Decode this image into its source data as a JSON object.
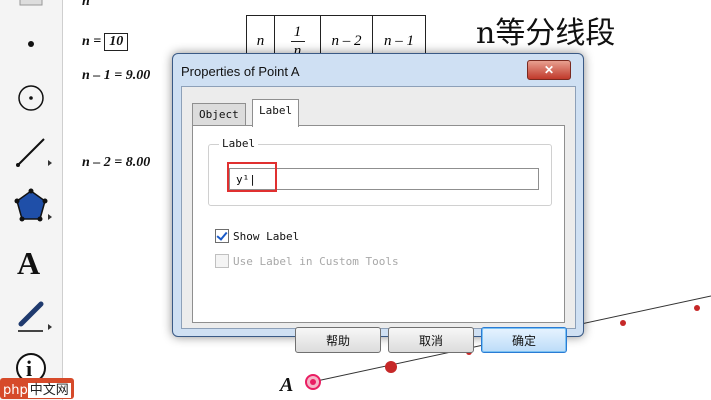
{
  "canvas": {
    "title": "n等分线段",
    "n_symbol": "n",
    "n_label": "n =",
    "n_value": "10",
    "n_minus_1": "n – 1 = 9.00",
    "n_minus_2": "n – 2 = 8.00",
    "point_label": "A"
  },
  "formula_table": {
    "cells": [
      "n",
      "1",
      "n – 2",
      "n – 1"
    ],
    "frac_den": "n"
  },
  "dialog": {
    "title": "Properties of Point A",
    "close_glyph": "✕",
    "tabs": [
      "Object",
      "Label"
    ],
    "active_tab": "Label",
    "group_title": "Label",
    "label_value": "y¹|",
    "show_label_text": "Show Label",
    "show_label_checked": true,
    "custom_tools_text": "Use Label in Custom Tools",
    "custom_tools_checked": false,
    "buttons": {
      "help": "帮助",
      "cancel": "取消",
      "ok": "确定"
    }
  },
  "watermark": {
    "logo": "php",
    "rest": "中文网"
  },
  "colors": {
    "dialog_frame": "#cfe0f3",
    "close_red": "#c0392b",
    "point_red": "#c62828",
    "point_pink": "#e91e63",
    "ok_blue": "#2a7bd4"
  }
}
